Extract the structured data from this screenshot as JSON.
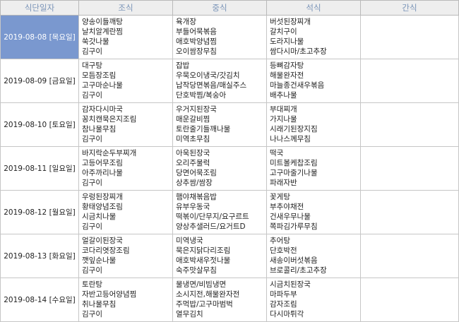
{
  "headers": [
    "식단일자",
    "조식",
    "중식",
    "석식",
    "간식"
  ],
  "rows": [
    {
      "date": "2019-08-08 [목요일]",
      "selected": true,
      "breakfast": [
        "양송이들깨탕",
        "날치알계란찜",
        "쑥갓나물",
        "김구이"
      ],
      "lunch": [
        "육개장",
        "부들어묵볶음",
        "애호박양념찜",
        "오이쌈장무침"
      ],
      "dinner": [
        "버섯된장찌개",
        "갈치구이",
        "도라지나물",
        "쌈다시마/초고추장"
      ],
      "snack": []
    },
    {
      "date": "2019-08-09 [금요일]",
      "selected": false,
      "breakfast": [
        "대구탕",
        "모듬장조림",
        "고구마순나물",
        "김구이"
      ],
      "lunch": [
        "잡밥",
        "우묵오이냉국/갓김치",
        "납작당면볶음/매실주스",
        "단호박찜/복숭아"
      ],
      "dinner": [
        "등뼈감자탕",
        "해물완자전",
        "마늘종건새우볶음",
        "배추나물"
      ],
      "snack": []
    },
    {
      "date": "2019-08-10 [토요일]",
      "selected": false,
      "breakfast": [
        "감자다시마국",
        "꽁치캔묵은지조림",
        "참나물무침",
        "김구이"
      ],
      "lunch": [
        "우거지된장국",
        "매운갈비찜",
        "토란줄기들깨나물",
        "미역초무침"
      ],
      "dinner": [
        "부대찌개",
        "가지나물",
        "시래기된장지짐",
        "나나스께무침"
      ],
      "snack": []
    },
    {
      "date": "2019-08-11 [일요일]",
      "selected": false,
      "breakfast": [
        "바지락순두부찌개",
        "고등어무조림",
        "아주까리나물",
        "김구이"
      ],
      "lunch": [
        "아욱된장국",
        "오리주물럭",
        "당면어묵조림",
        "상추쌈/쌈장"
      ],
      "dinner": [
        "떡국",
        "미트볼케찹조림",
        "고구마줄기나물",
        "파래자반"
      ],
      "snack": []
    },
    {
      "date": "2019-08-12 [월요일]",
      "selected": false,
      "breakfast": [
        "우렁된장찌개",
        "황태양념조림",
        "시금치나물",
        "김구이"
      ],
      "lunch": [
        "햄야채볶음밥",
        "유부우동국",
        "떡볶이/단무지/요구르트",
        "양상추샐러드/요거트D"
      ],
      "dinner": [
        "꽃게탕",
        "부추야채전",
        "건새우무나물",
        "쪽파김가루무침"
      ],
      "snack": []
    },
    {
      "date": "2019-08-13 [화요일]",
      "selected": false,
      "breakfast": [
        "얼갈이된장국",
        "코다리엿장조림",
        "깻잎순나물",
        "김구이"
      ],
      "lunch": [
        "미역냉국",
        "묵은지닭다리조림",
        "애호박새우젓나물",
        "숙주맛살무침"
      ],
      "dinner": [
        "추어탕",
        "단호박전",
        "새송이버섯볶음",
        "브로콜리/초고추장"
      ],
      "snack": []
    },
    {
      "date": "2019-08-14 [수요일]",
      "selected": false,
      "breakfast": [
        "토란탕",
        "자반고등어양념찜",
        "취나물무침",
        "김구이"
      ],
      "lunch": [
        "물냉면/비빔냉면",
        "소시지전,해물완자전",
        "주먹밥/고구마범벅",
        "열무김치"
      ],
      "dinner": [
        "시금치된장국",
        "마파두부",
        "감자조림",
        "다시마튀각"
      ],
      "snack": []
    }
  ]
}
